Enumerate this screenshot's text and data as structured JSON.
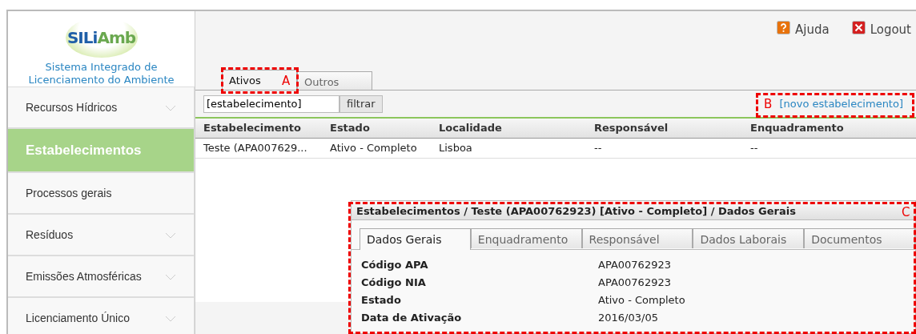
{
  "header": {
    "logo": [
      {
        "text": "SILi",
        "color": "#1f5fa8"
      },
      {
        "text": "Amb",
        "color": "#6aa84f"
      }
    ],
    "subtitle": "Sistema Integrado de Licenciamento do Ambiente",
    "links": [
      {
        "label": "Ajuda",
        "kind": "help"
      },
      {
        "label": "Logout",
        "kind": "logout"
      }
    ]
  },
  "sidebar": {
    "items": [
      {
        "label": "Recursos Hídricos",
        "selected": false,
        "expandable": true
      },
      {
        "label": "Estabelecimentos",
        "selected": true,
        "expandable": false
      },
      {
        "label": "Processos gerais",
        "selected": false,
        "expandable": false
      },
      {
        "label": "Resíduos",
        "selected": false,
        "expandable": true
      },
      {
        "label": "Emissões Atmosféricas",
        "selected": false,
        "expandable": true
      },
      {
        "label": "Licenciamento Único",
        "selected": false,
        "expandable": true
      }
    ]
  },
  "tabs": [
    {
      "label": "Ativos",
      "selected": true
    },
    {
      "label": "Outros",
      "selected": false
    }
  ],
  "search": {
    "value": "[estabelecimento]",
    "button": "filtrar"
  },
  "new_link": "[novo estabelecimento]",
  "table": {
    "columns": [
      "Estabelecimento",
      "Estado",
      "Localidade",
      "Responsável",
      "Enquadramento"
    ],
    "rows": [
      [
        "Teste (APA007629...",
        "Ativo - Completo",
        "Lisboa",
        "--",
        "--"
      ]
    ]
  },
  "detail": {
    "title": "Estabelecimentos / Teste (APA00762923) [Ativo - Completo] / Dados Gerais",
    "tabs": [
      {
        "label": "Dados Gerais",
        "selected": true
      },
      {
        "label": "Enquadramento",
        "selected": false
      },
      {
        "label": "Responsável",
        "selected": false
      },
      {
        "label": "Dados Laborais",
        "selected": false
      },
      {
        "label": "Documentos",
        "selected": false
      }
    ],
    "fields": [
      {
        "label": "Código APA",
        "value": "APA00762923"
      },
      {
        "label": "Código NIA",
        "value": "APA00762923"
      },
      {
        "label": "Estado",
        "value": "Ativo - Completo"
      },
      {
        "label": "Data de Ativação",
        "value": "2016/03/05"
      }
    ]
  },
  "annotations": [
    {
      "label": "A"
    },
    {
      "label": "B"
    },
    {
      "label": "C"
    }
  ]
}
